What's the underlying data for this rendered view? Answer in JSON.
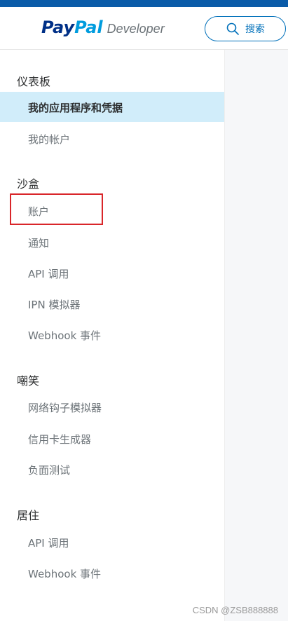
{
  "header": {
    "logo_pay": "Pay",
    "logo_pal": "Pal",
    "logo_dev": "Developer",
    "search_label": "搜索"
  },
  "sidebar": {
    "sections": [
      {
        "title": "仪表板"
      },
      {
        "title": "沙盒"
      },
      {
        "title": "嘲笑"
      },
      {
        "title": "居住"
      }
    ],
    "dashboard_items": [
      "我的应用程序和凭据",
      "我的帐户"
    ],
    "sandbox_items": [
      "账户",
      "通知",
      "API 调用",
      "IPN 模拟器",
      "Webhook 事件"
    ],
    "mock_items": [
      "网络钩子模拟器",
      "信用卡生成器",
      "负面测试"
    ],
    "live_items": [
      "API 调用",
      "Webhook 事件"
    ],
    "active_item": "我的应用程序和凭据"
  },
  "watermark": "CSDN @ZSB888888",
  "colors": {
    "topbar": "#0a5ba8",
    "active_bg": "#d1edfa",
    "accent": "#0070ba",
    "highlight": "#d9262a"
  }
}
